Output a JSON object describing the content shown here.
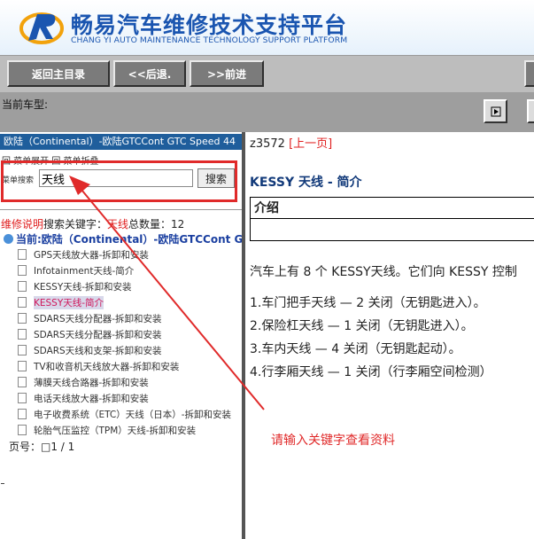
{
  "header": {
    "title_cn": "畅易汽车维修技术支持平台",
    "title_en": "CHANG YI AUTO MAINTENANCE TECHNOLOGY SUPPORT PLATFORM"
  },
  "toolbar": {
    "home_label": "返回主目录",
    "back_label": "<<后退.",
    "forward_label": ">>前进"
  },
  "model": {
    "label": "当前车型:"
  },
  "left": {
    "car_banner": "欧陆（Continental）-欧陆GTCCont GTC Speed 44",
    "expand": "回 菜单展开   回 菜单折叠",
    "search_label": "菜单搜索",
    "search_value": "天线",
    "search_button": "搜索",
    "result": {
      "prefix": "维修说明",
      "middle": "搜索关键字：",
      "keyword": "天线",
      "count_label": "总数量：12"
    },
    "current": "当前:欧陆（Continental）-欧陆GTCCont GTC",
    "items": [
      "GPS天线放大器-拆卸和安装",
      "Infotainment天线-简介",
      "KESSY天线-拆卸和安装",
      "KESSY天线-简介",
      "SDARS天线分配器-拆卸和安装",
      "SDARS天线分配器-拆卸和安装",
      "SDARS天线和支架-拆卸和安装",
      "TV和收音机天线放大器-拆卸和安装",
      "薄膜天线合路器-拆卸和安装",
      "电话天线放大器-拆卸和安装",
      "电子收费系统（ETC）天线（日本）-拆卸和安装",
      "轮胎气压监控（TPM）天线-拆卸和安装"
    ],
    "active_index": 3,
    "pager": "页号：□1 / 1"
  },
  "right": {
    "doc_id": "z3572",
    "prev_link": "[上一页]",
    "title": "KESSY 天线 - 简介",
    "intro_header": "介绍",
    "paragraph": "汽车上有 8 个 KESSY天线。它们向 KESSY 控制",
    "list": [
      "1.车门把手天线 — 2 关闭（无钥匙进入）。",
      "2.保险杠天线 — 1 关闭（无钥匙进入）。",
      "3.车内天线 — 4 关闭（无钥匙起动）。",
      "4.行李厢天线 — 1 关闭（行李厢空间检测）"
    ]
  },
  "annotation": "请输入关键字查看资料",
  "colors": {
    "accent": "#1a55b0",
    "highlight": "#e02a2a",
    "banner": "#1f5e9c"
  }
}
